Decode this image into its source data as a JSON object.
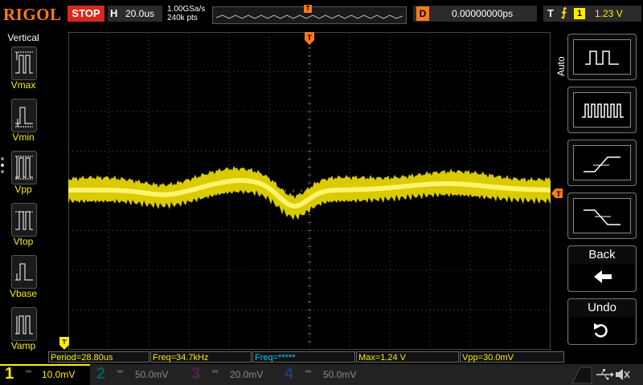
{
  "topbar": {
    "logo": "RIGOL",
    "run_status": "STOP",
    "horizontal_letter": "H",
    "timebase": "20.0us",
    "sample_rate": "1.00GSa/s",
    "memory_depth": "240k pts",
    "delay_letter": "D",
    "delay": "0.00000000ps",
    "trigger_letter": "T",
    "trigger_edge": "⨍",
    "trigger_channel": "1",
    "trigger_level": "1.23 V"
  },
  "left_panel": {
    "title": "Vertical",
    "items": [
      {
        "label": "Vmax",
        "icon": "vmax-icon"
      },
      {
        "label": "Vmin",
        "icon": "vmin-icon"
      },
      {
        "label": "Vpp",
        "icon": "vpp-icon"
      },
      {
        "label": "Vtop",
        "icon": "vtop-icon"
      },
      {
        "label": "Vbase",
        "icon": "vbase-icon"
      },
      {
        "label": "Vamp",
        "icon": "vamp-icon"
      }
    ]
  },
  "right_menu": {
    "mode_label": "Auto",
    "buttons": [
      {
        "name": "square-wave-icon"
      },
      {
        "name": "pulse-train-icon"
      },
      {
        "name": "rising-edge-icon"
      },
      {
        "name": "falling-edge-icon"
      }
    ],
    "back_label": "Back",
    "undo_label": "Undo"
  },
  "measurements": [
    {
      "text": "Period=28.80us",
      "color": "#ffee00"
    },
    {
      "text": "Freq=34.7kHz",
      "color": "#ffee00"
    },
    {
      "text": "Freq=*****",
      "color": "#00d0ff"
    },
    {
      "text": "Max=1.24 V",
      "color": "#ffee00"
    },
    {
      "text": "Vpp=30.0mV",
      "color": "#ffee00"
    }
  ],
  "channels": [
    {
      "num": "1",
      "scale": "10.0mV",
      "color": "#ffee00",
      "active": true
    },
    {
      "num": "2",
      "scale": "50.0mV",
      "color": "#00c8c8",
      "active": false
    },
    {
      "num": "3",
      "scale": "20.0mV",
      "color": "#d040d0",
      "active": false
    },
    {
      "num": "4",
      "scale": "50.0mV",
      "color": "#3060ff",
      "active": false
    }
  ],
  "colors": {
    "ch1": "#ffee00",
    "accent": "#ff7a1a",
    "stop": "#d62a1c",
    "grid": "#555555"
  }
}
